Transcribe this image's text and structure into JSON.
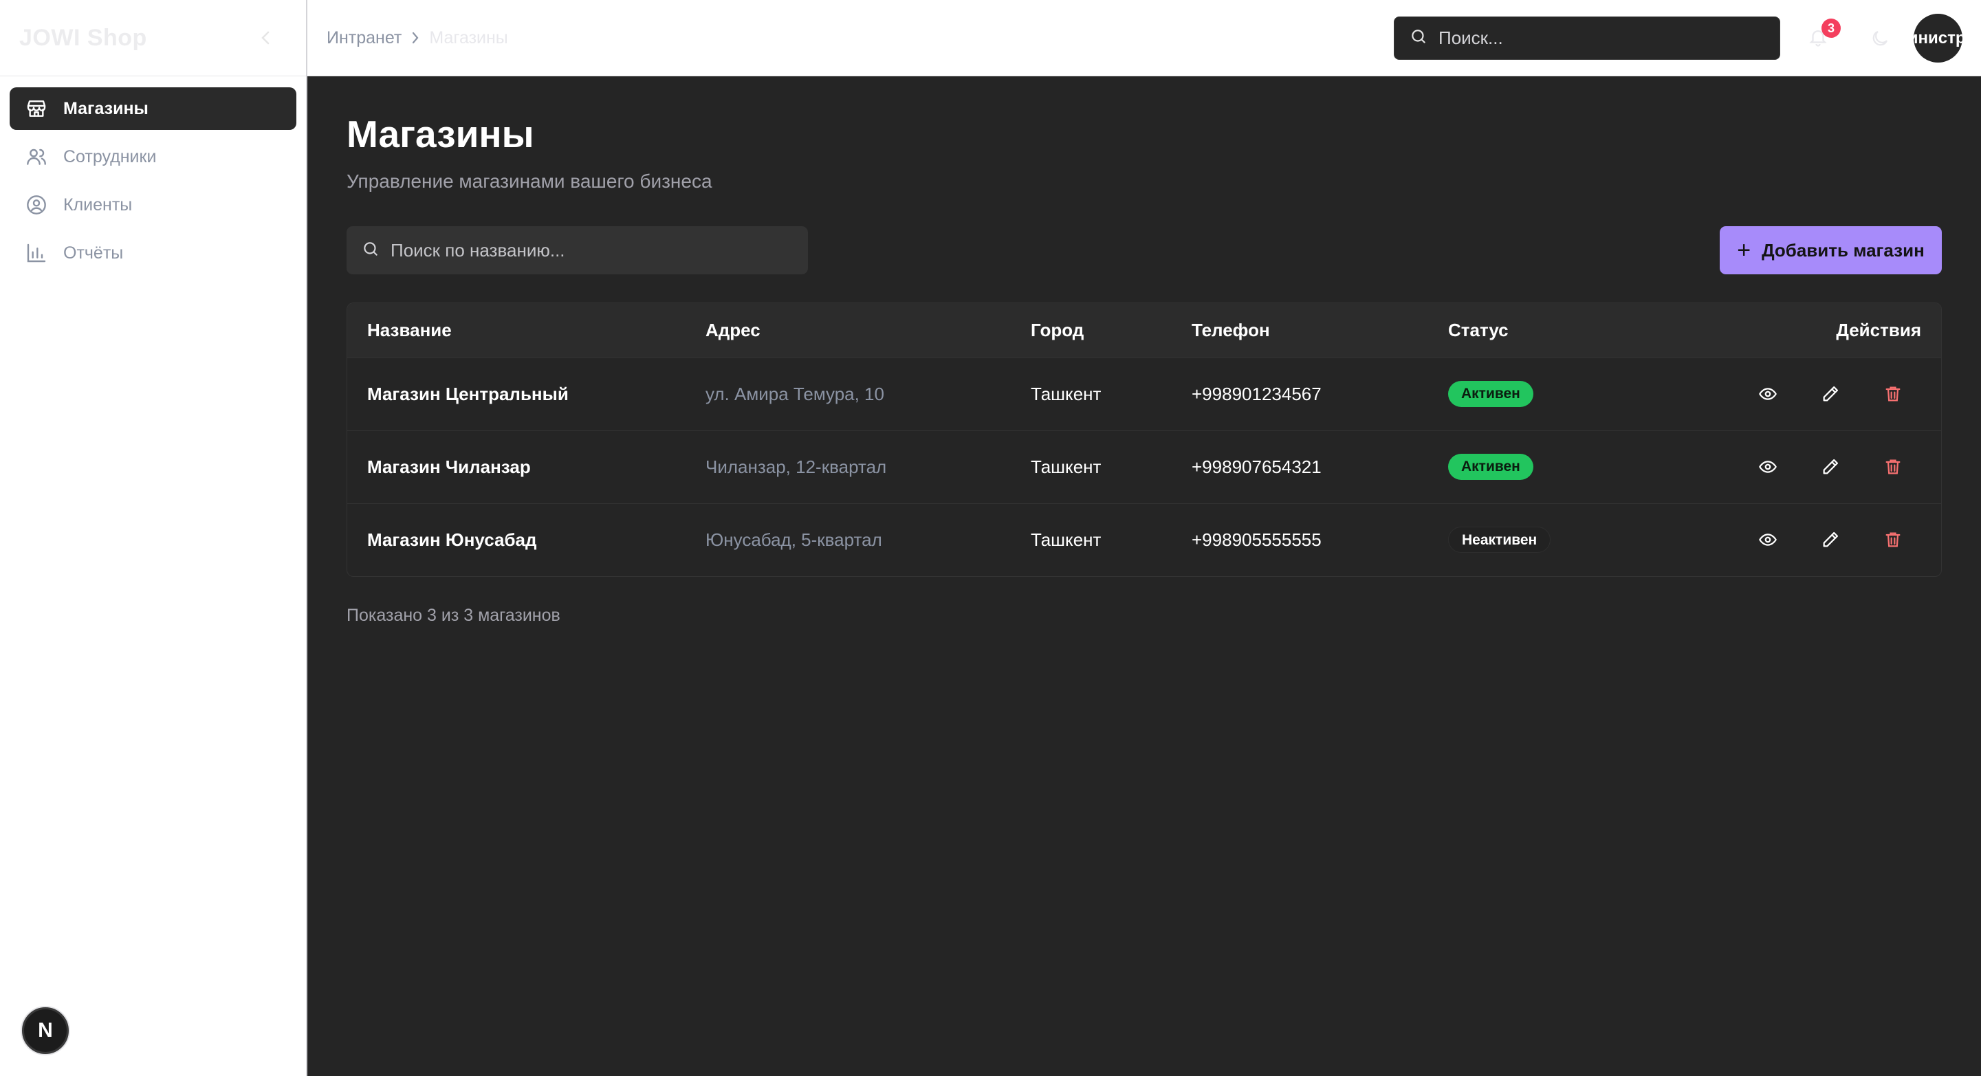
{
  "app": {
    "brand": "JOWI Shop"
  },
  "sidebar": {
    "items": [
      {
        "label": "Магазины",
        "icon": "store-icon",
        "active": true
      },
      {
        "label": "Сотрудники",
        "icon": "users-icon",
        "active": false
      },
      {
        "label": "Клиенты",
        "icon": "user-circle-icon",
        "active": false
      },
      {
        "label": "Отчёты",
        "icon": "bar-chart-icon",
        "active": false
      }
    ],
    "footer_badge": "N"
  },
  "topbar": {
    "breadcrumb": {
      "home": "Интранет",
      "current": "Магазины"
    },
    "search_placeholder": "Поиск...",
    "notification_count": "3",
    "avatar_text": "Администратор"
  },
  "page": {
    "title": "Магазины",
    "subtitle": "Управление магазинами вашего бизнеса",
    "filter_placeholder": "Поиск по названию...",
    "add_button_label": "Добавить магазин",
    "add_button_icon": "plus-icon",
    "footer_note": "Показано 3 из 3 магазинов"
  },
  "table": {
    "columns": [
      "Название",
      "Адрес",
      "Город",
      "Телефон",
      "Статус",
      "Действия"
    ],
    "rows": [
      {
        "name": "Магазин Центральный",
        "address": "ул. Амира Темура, 10",
        "city": "Ташкент",
        "phone": "+998901234567",
        "status": "Активен",
        "status_type": "active"
      },
      {
        "name": "Магазин Чиланзар",
        "address": "Чиланзар, 12-квартал",
        "city": "Ташкент",
        "phone": "+998907654321",
        "status": "Активен",
        "status_type": "active"
      },
      {
        "name": "Магазин Юнусабад",
        "address": "Юнусабад, 5-квартал",
        "city": "Ташкент",
        "phone": "+998905555555",
        "status": "Неактивен",
        "status_type": "inactive"
      }
    ],
    "row_actions": [
      "eye-icon",
      "pencil-icon",
      "trash-icon"
    ]
  },
  "colors": {
    "accent": "#a78bfa",
    "active_badge": "#22c55e",
    "danger": "#f87171",
    "notification": "#f43f5e"
  }
}
